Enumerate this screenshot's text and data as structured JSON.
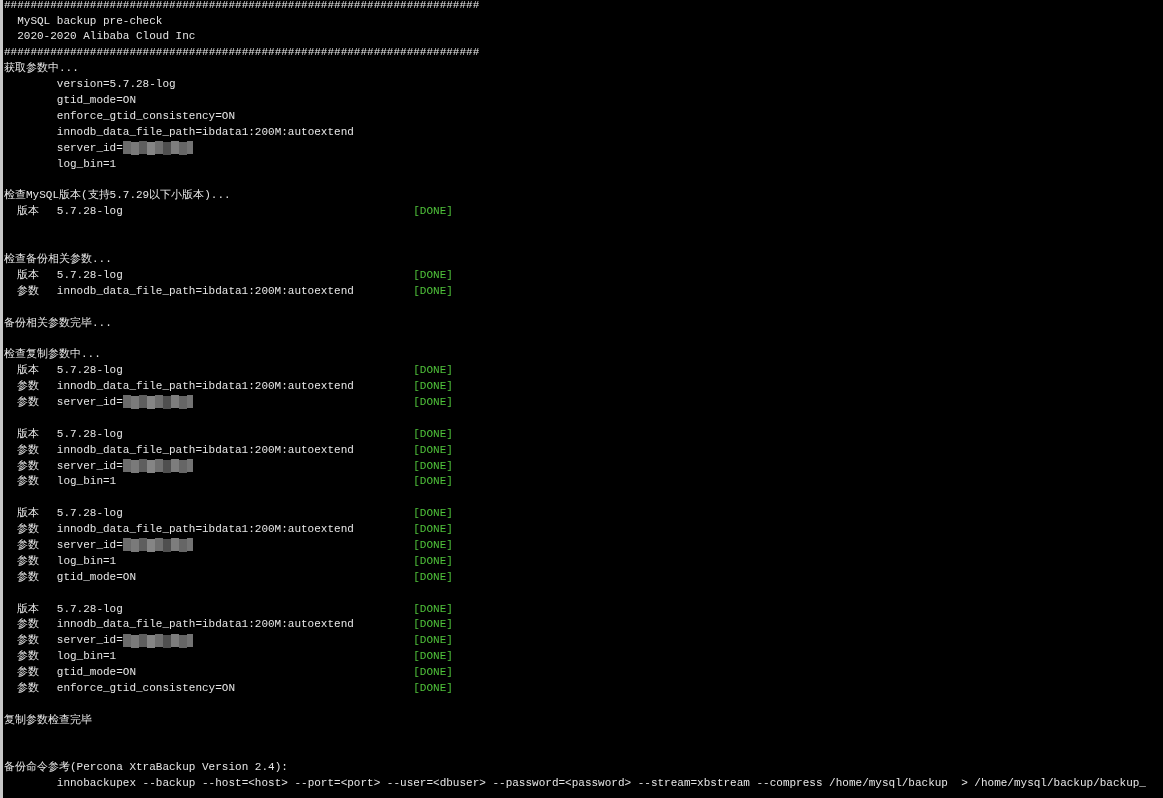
{
  "terminal": {
    "lines": [
      {
        "kind": "rule",
        "text": "########################################################################"
      },
      {
        "kind": "title",
        "text": "MySQL backup pre-check"
      },
      {
        "kind": "title",
        "text": "2020-2020 Alibaba Cloud Inc"
      },
      {
        "kind": "rule",
        "text": "########################################################################"
      },
      {
        "kind": "heading",
        "text": "获取参数中..."
      },
      {
        "kind": "param",
        "text": "version=5.7.28-log"
      },
      {
        "kind": "param",
        "text": "gtid_mode=ON"
      },
      {
        "kind": "param",
        "text": "enforce_gtid_consistency=ON"
      },
      {
        "kind": "param",
        "text": "innodb_data_file_path=ibdata1:200M:autoextend"
      },
      {
        "kind": "param",
        "text": "server_id=",
        "redacted": true
      },
      {
        "kind": "param",
        "text": "log_bin=1"
      },
      {
        "kind": "blank"
      },
      {
        "kind": "heading",
        "text": "检查MySQL版本(支持5.7.29以下小版本)..."
      },
      {
        "kind": "check",
        "tag": "版本",
        "value": "5.7.28-log",
        "status": "[DONE]"
      },
      {
        "kind": "blank"
      },
      {
        "kind": "blank"
      },
      {
        "kind": "heading",
        "text": "检查备份相关参数..."
      },
      {
        "kind": "check",
        "tag": "版本",
        "value": "5.7.28-log",
        "status": "[DONE]"
      },
      {
        "kind": "check",
        "tag": "参数",
        "value": "innodb_data_file_path=ibdata1:200M:autoextend",
        "status": "[DONE]"
      },
      {
        "kind": "blank"
      },
      {
        "kind": "heading",
        "text": "备份相关参数完毕..."
      },
      {
        "kind": "blank"
      },
      {
        "kind": "heading",
        "text": "检查复制参数中..."
      },
      {
        "kind": "check",
        "tag": "版本",
        "value": "5.7.28-log",
        "status": "[DONE]"
      },
      {
        "kind": "check",
        "tag": "参数",
        "value": "innodb_data_file_path=ibdata1:200M:autoextend",
        "status": "[DONE]"
      },
      {
        "kind": "check",
        "tag": "参数",
        "value": "server_id=",
        "redacted": true,
        "status": "[DONE]"
      },
      {
        "kind": "blank"
      },
      {
        "kind": "check",
        "tag": "版本",
        "value": "5.7.28-log",
        "status": "[DONE]"
      },
      {
        "kind": "check",
        "tag": "参数",
        "value": "innodb_data_file_path=ibdata1:200M:autoextend",
        "status": "[DONE]"
      },
      {
        "kind": "check",
        "tag": "参数",
        "value": "server_id=",
        "redacted": true,
        "status": "[DONE]"
      },
      {
        "kind": "check",
        "tag": "参数",
        "value": "log_bin=1",
        "status": "[DONE]"
      },
      {
        "kind": "blank"
      },
      {
        "kind": "check",
        "tag": "版本",
        "value": "5.7.28-log",
        "status": "[DONE]"
      },
      {
        "kind": "check",
        "tag": "参数",
        "value": "innodb_data_file_path=ibdata1:200M:autoextend",
        "status": "[DONE]"
      },
      {
        "kind": "check",
        "tag": "参数",
        "value": "server_id=",
        "redacted": true,
        "status": "[DONE]"
      },
      {
        "kind": "check",
        "tag": "参数",
        "value": "log_bin=1",
        "status": "[DONE]"
      },
      {
        "kind": "check",
        "tag": "参数",
        "value": "gtid_mode=ON",
        "status": "[DONE]"
      },
      {
        "kind": "blank"
      },
      {
        "kind": "check",
        "tag": "版本",
        "value": "5.7.28-log",
        "status": "[DONE]"
      },
      {
        "kind": "check",
        "tag": "参数",
        "value": "innodb_data_file_path=ibdata1:200M:autoextend",
        "status": "[DONE]"
      },
      {
        "kind": "check",
        "tag": "参数",
        "value": "server_id=",
        "redacted": true,
        "status": "[DONE]"
      },
      {
        "kind": "check",
        "tag": "参数",
        "value": "log_bin=1",
        "status": "[DONE]"
      },
      {
        "kind": "check",
        "tag": "参数",
        "value": "gtid_mode=ON",
        "status": "[DONE]"
      },
      {
        "kind": "check",
        "tag": "参数",
        "value": "enforce_gtid_consistency=ON",
        "status": "[DONE]"
      },
      {
        "kind": "blank"
      },
      {
        "kind": "heading",
        "text": "复制参数检查完毕"
      },
      {
        "kind": "blank"
      },
      {
        "kind": "blank"
      },
      {
        "kind": "heading",
        "text": "备份命令参考(Percona XtraBackup Version 2.4):"
      },
      {
        "kind": "param",
        "text": "innobackupex --backup --host=<host> --port=<port> --user=<dbuser> --password=<password> --stream=xbstream --compress /home/mysql/backup  > /home/mysql/backup/backup_"
      }
    ]
  }
}
